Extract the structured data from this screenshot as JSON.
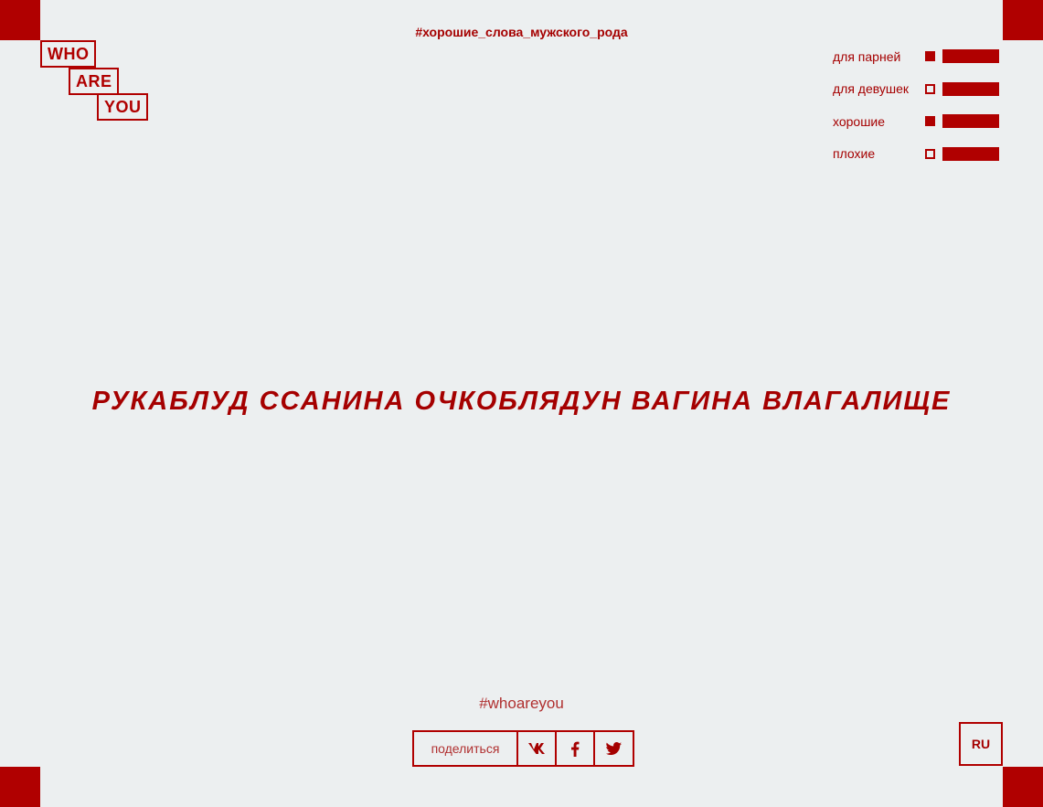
{
  "logo": {
    "line1": "WHO",
    "line2": "ARE",
    "line3": "YOU"
  },
  "top_tag": "#хорошие_слова_мужского_рода",
  "filters": [
    {
      "label": "для парней",
      "checked": true
    },
    {
      "label": "для девушек",
      "checked": false
    },
    {
      "label": "хорошие",
      "checked": true
    },
    {
      "label": "плохие",
      "checked": false
    }
  ],
  "words": "РУКАБЛУД ССАНИНА ОЧКОБЛЯДУН ВАГИНА ВЛАГАЛИЩЕ",
  "hashtag": "#whoareyou",
  "share": {
    "label": "поделиться",
    "buttons": [
      {
        "icon": "vk-icon"
      },
      {
        "icon": "facebook-icon"
      },
      {
        "icon": "twitter-icon"
      }
    ]
  },
  "language": "RU",
  "colors": {
    "accent": "#b00000",
    "text": "#a50000",
    "background": "#eceff0"
  }
}
